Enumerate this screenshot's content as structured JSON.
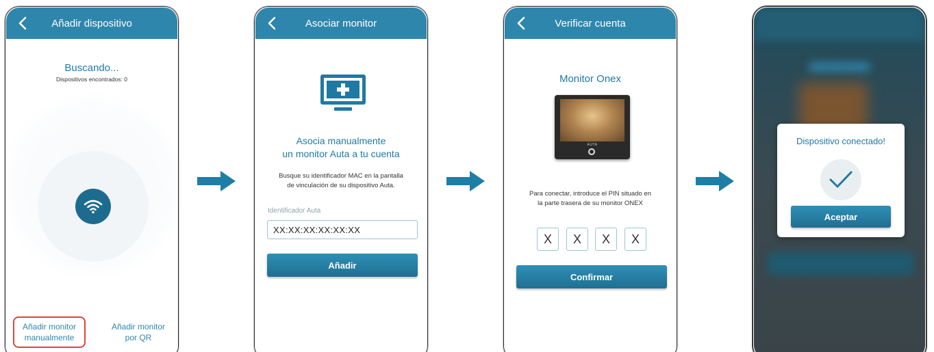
{
  "screen1": {
    "title": "Añadir dispositivo",
    "status": "Buscando...",
    "found_text": "Dispositivos encontrados: 0",
    "manual_line1": "Añadir monitor",
    "manual_line2": "manualmente",
    "qr_line1": "Añadir monitor",
    "qr_line2": "por QR",
    "icons": [
      "back-icon",
      "wifi-icon"
    ]
  },
  "screen2": {
    "title": "Asociar monitor",
    "heading_line1": "Asocia manualmente",
    "heading_line2": "un monitor Auta a tu cuenta",
    "desc_line1": "Busque su identificador MAC en la pantalla",
    "desc_line2": "de vinculación de su dispositivo Auta.",
    "field_label": "Identificador Auta",
    "field_value": "XX:XX:XX:XX:XX:XX",
    "button": "Añadir",
    "icons": [
      "back-icon",
      "monitor-add-icon"
    ]
  },
  "screen3": {
    "title": "Verificar cuenta",
    "heading": "Monitor Onex",
    "device_brand": "AUTA",
    "desc_line1": "Para conectar, introduce el PIN situado en",
    "desc_line2": "la parte trasera de su monitor ONEX",
    "pin": [
      "X",
      "X",
      "X",
      "X"
    ],
    "button": "Confirmar",
    "icons": [
      "back-icon"
    ]
  },
  "screen4": {
    "dialog_title": "Dispositivo conectado!",
    "dialog_button": "Aceptar",
    "icons": [
      "checkmark-icon"
    ]
  },
  "colors": {
    "accent": "#2e86ad",
    "text_accent": "#1f7aa3",
    "highlight": "#e0433f"
  }
}
